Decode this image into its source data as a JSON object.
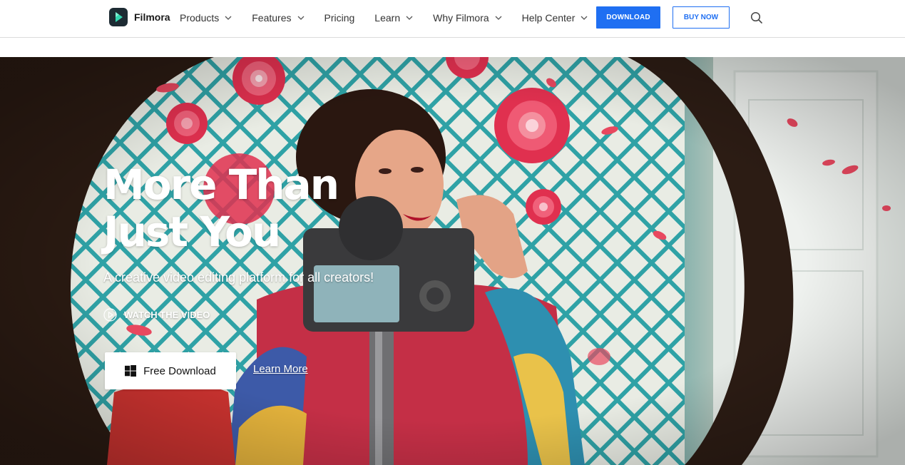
{
  "brand": {
    "name": "Filmora",
    "accent": "#1f6ff2"
  },
  "nav": {
    "items": [
      {
        "label": "Products",
        "has_dropdown": true
      },
      {
        "label": "Features",
        "has_dropdown": true
      },
      {
        "label": "Pricing",
        "has_dropdown": false
      },
      {
        "label": "Learn",
        "has_dropdown": true
      },
      {
        "label": "Why Filmora",
        "has_dropdown": true
      },
      {
        "label": "Help Center",
        "has_dropdown": true
      }
    ],
    "download_label": "DOWNLOAD",
    "buy_label": "BUY NOW",
    "search_icon": "search-icon"
  },
  "hero": {
    "title_line1": "More Than",
    "title_line2": "Just You",
    "subtitle": "A creative video editing platform for all creators!",
    "watch_label": "WATCH THE VIDEO",
    "free_download_label": "Free Download",
    "learn_more_label": "Learn More"
  }
}
